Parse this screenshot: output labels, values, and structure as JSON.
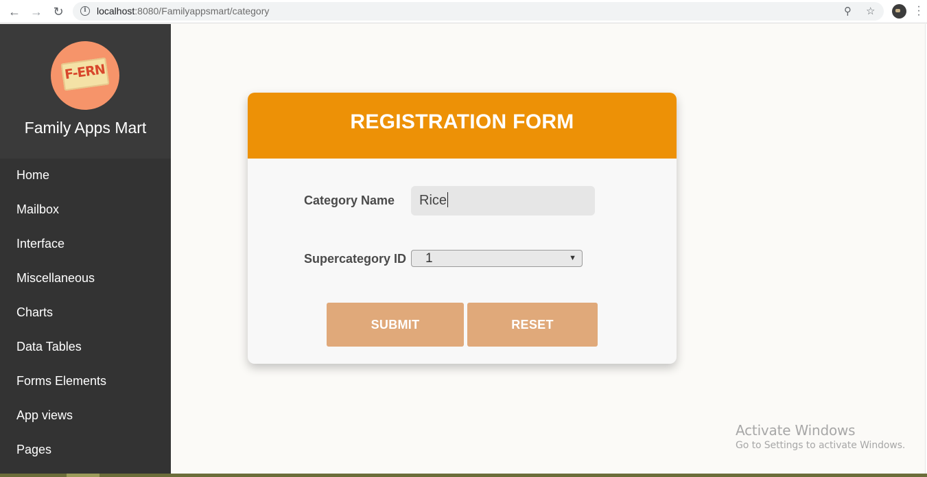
{
  "browser": {
    "url_host": "localhost",
    "url_rest": ":8080/Familyappsmart/category"
  },
  "sidebar": {
    "logo_text": "F-ERN",
    "brand_title": "Family Apps Mart",
    "items": [
      {
        "label": "Home"
      },
      {
        "label": "Mailbox"
      },
      {
        "label": "Interface"
      },
      {
        "label": "Miscellaneous"
      },
      {
        "label": "Charts"
      },
      {
        "label": "Data Tables"
      },
      {
        "label": "Forms Elements"
      },
      {
        "label": "App views"
      },
      {
        "label": "Pages"
      }
    ]
  },
  "form": {
    "title": "REGISTRATION FORM",
    "category_label": "Category Name",
    "category_value": "Rice",
    "supercategory_label": "Supercategory ID",
    "supercategory_value": "1",
    "submit_label": "SUBMIT",
    "reset_label": "RESET"
  },
  "watermark": {
    "line1": "Activate Windows",
    "line2": "Go to Settings to activate Windows."
  },
  "colors": {
    "header": "#ed9106",
    "button": "#e0a97a",
    "sidebar": "#333333"
  }
}
